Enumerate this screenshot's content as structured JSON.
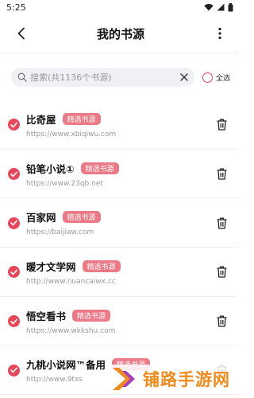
{
  "status": {
    "time": "5:25"
  },
  "header": {
    "title": "我的书源"
  },
  "search": {
    "placeholder": "搜索(共1136个书源)",
    "select_all_label": "全选"
  },
  "sources": [
    {
      "name": "比奇屋",
      "badge": "精选书源",
      "url": "https://www.xbiqiwu.com"
    },
    {
      "name": "铅笔小说①",
      "badge": "精选书源",
      "url": "https://www.23qb.net"
    },
    {
      "name": "百家网",
      "badge": "精选书源",
      "url": "https://baijiaw.com"
    },
    {
      "name": "暖才文学网",
      "badge": "精选书源",
      "url": "http://www.nuancaiwx.cc"
    },
    {
      "name": "悟空看书",
      "badge": "精选书源",
      "url": "https://www.wkkshu.com"
    },
    {
      "name": "九桃小说网™备用",
      "badge": "精选书源",
      "url": "http://www.9txs"
    }
  ],
  "watermark": {
    "text": "铺路手游网"
  },
  "colors": {
    "accent": "#e8475a",
    "badge": "#ec7986",
    "watermark": "#f08a1a"
  }
}
